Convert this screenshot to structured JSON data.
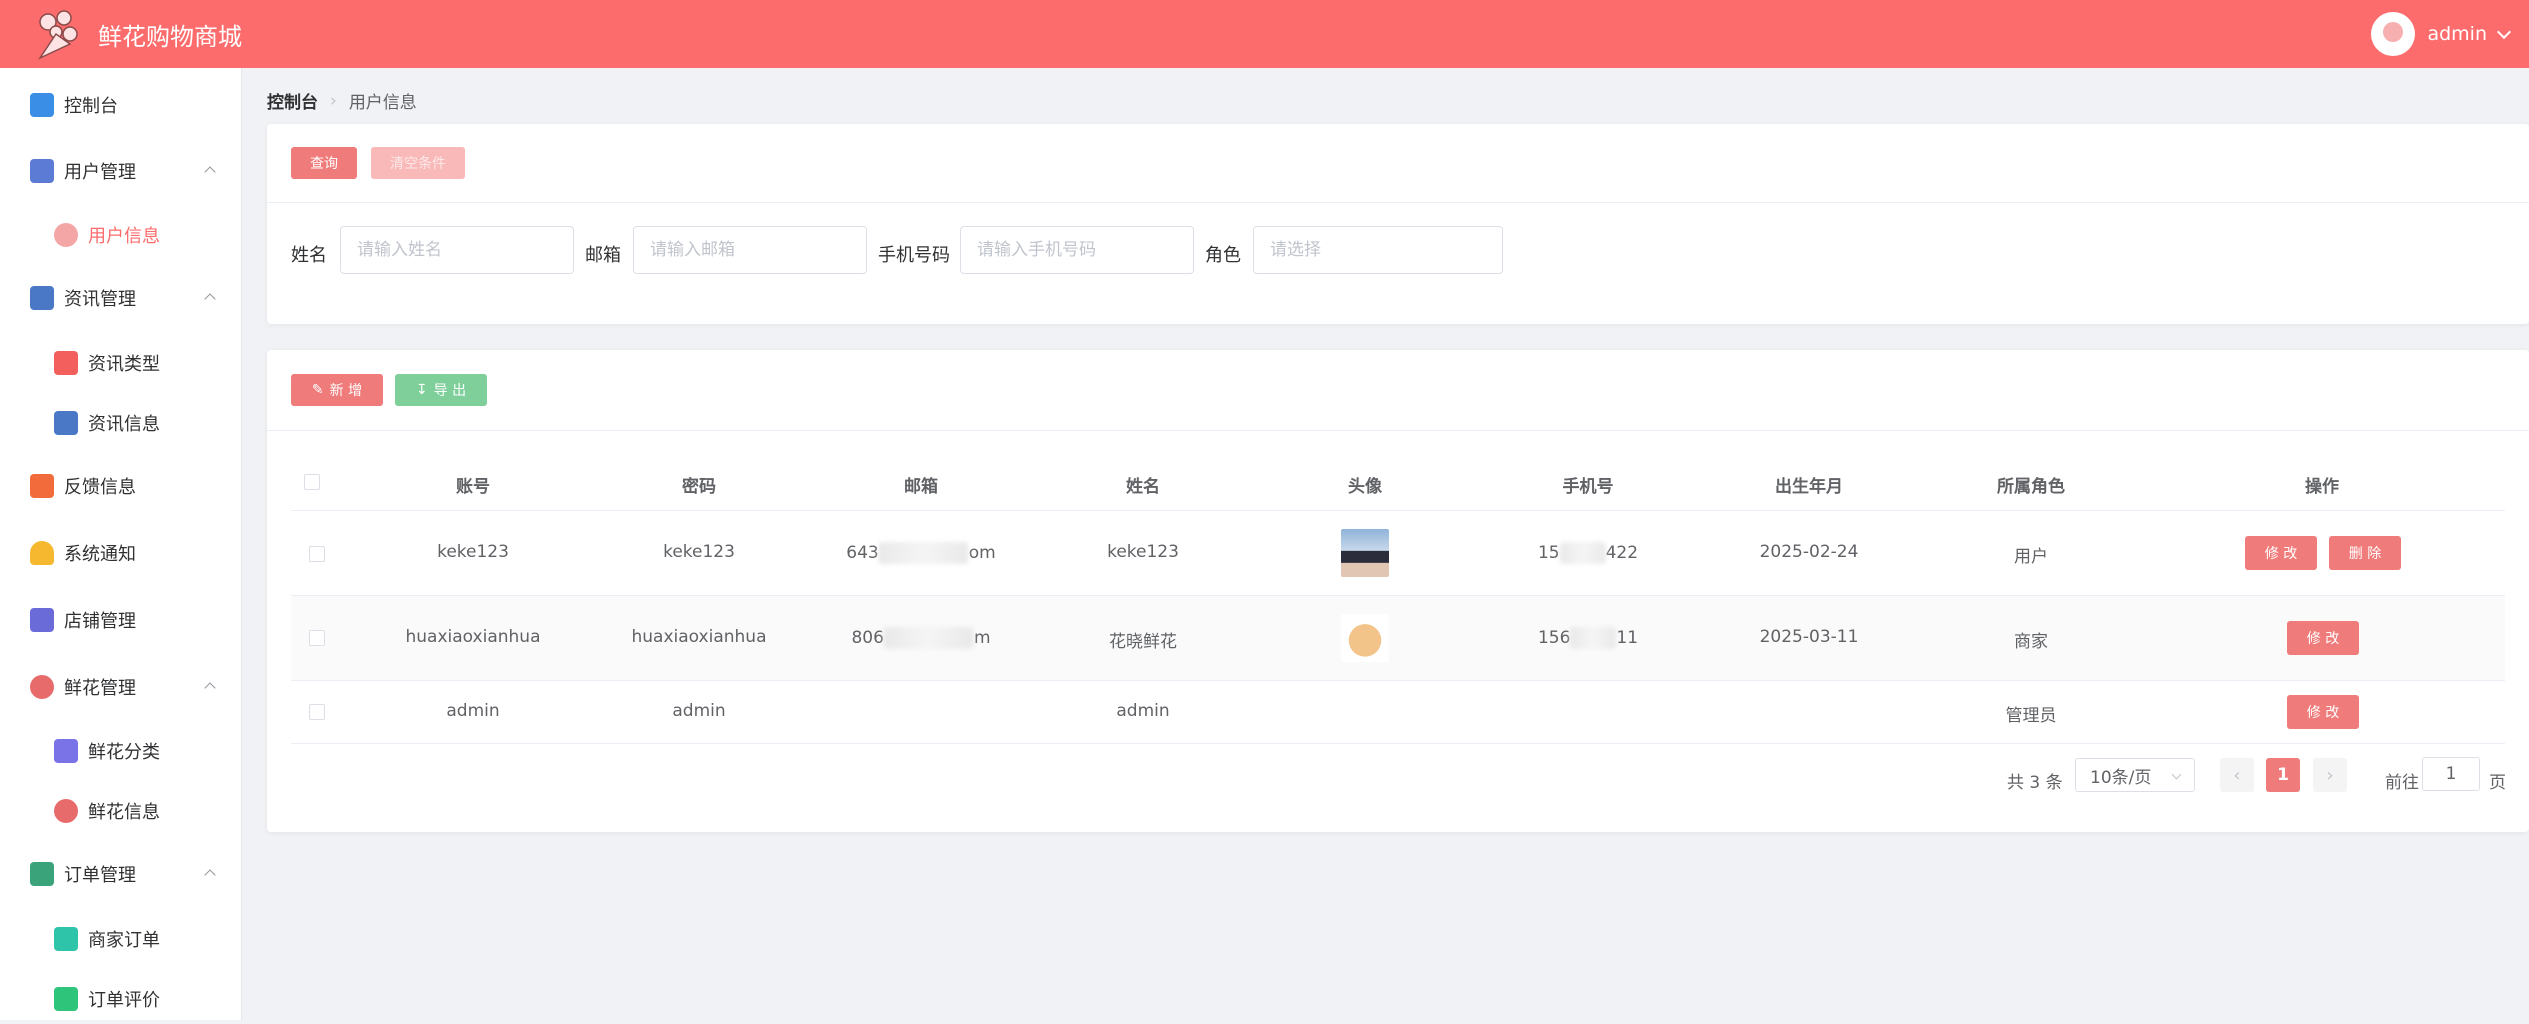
{
  "header": {
    "title": "鲜花购物商城",
    "username": "admin"
  },
  "sidebar": {
    "items": [
      {
        "label": "控制台",
        "icon": "dashboard-icon",
        "color": "#3a8ee6"
      },
      {
        "label": "用户管理",
        "icon": "user-manage-icon",
        "color": "#5b7bd5"
      },
      {
        "label": "用户信息",
        "icon": "user-info-icon",
        "color": "#f4a6a6"
      },
      {
        "label": "资讯管理",
        "icon": "news-manage-icon",
        "color": "#4a78c7"
      },
      {
        "label": "资讯类型",
        "icon": "news-type-icon",
        "color": "#f25f5c"
      },
      {
        "label": "资讯信息",
        "icon": "news-info-icon",
        "color": "#4a78c7"
      },
      {
        "label": "反馈信息",
        "icon": "feedback-icon",
        "color": "#f26b3a"
      },
      {
        "label": "系统通知",
        "icon": "bell-icon",
        "color": "#f5b82e"
      },
      {
        "label": "店铺管理",
        "icon": "shop-icon",
        "color": "#6a6bd8"
      },
      {
        "label": "鲜花管理",
        "icon": "flower-manage-icon",
        "color": "#e86b6b"
      },
      {
        "label": "鲜花分类",
        "icon": "flower-category-icon",
        "color": "#7a73e8"
      },
      {
        "label": "鲜花信息",
        "icon": "flower-info-icon",
        "color": "#e86b6b"
      },
      {
        "label": "订单管理",
        "icon": "order-manage-icon",
        "color": "#3aa37a"
      },
      {
        "label": "商家订单",
        "icon": "merchant-order-icon",
        "color": "#2ec4a9"
      },
      {
        "label": "订单评价",
        "icon": "order-review-icon",
        "color": "#2ec47a"
      }
    ]
  },
  "breadcrumb": {
    "root": "控制台",
    "current": "用户信息"
  },
  "search": {
    "query_label": "查询",
    "clear_label": "清空条件",
    "name_label": "姓名",
    "name_placeholder": "请输入姓名",
    "email_label": "邮箱",
    "email_placeholder": "请输入邮箱",
    "phone_label": "手机号码",
    "phone_placeholder": "请输入手机号码",
    "role_label": "角色",
    "role_placeholder": "请选择"
  },
  "toolbar": {
    "add_label": "新 增",
    "export_label": "导 出"
  },
  "table": {
    "columns": [
      "账号",
      "密码",
      "邮箱",
      "姓名",
      "头像",
      "手机号",
      "出生年月",
      "所属角色",
      "操作"
    ],
    "rows": [
      {
        "account": "keke123",
        "password": "keke123",
        "email_start": "643",
        "email_end": "om",
        "name": "keke123",
        "phone_start": "15",
        "phone_end": "422",
        "birth": "2025-02-24",
        "role": "用户",
        "avatar": "girl-avatar-image"
      },
      {
        "account": "huaxiaoxianhua",
        "password": "huaxiaoxianhua",
        "email_start": "806",
        "email_end": "m",
        "name": "花晓鲜花",
        "phone_start": "156",
        "phone_end": "11",
        "birth": "2025-03-11",
        "role": "商家",
        "avatar": "cat-avatar-image"
      },
      {
        "account": "admin",
        "password": "admin",
        "email_start": "",
        "email_end": "",
        "name": "admin",
        "phone_start": "",
        "phone_end": "",
        "birth": "",
        "role": "管理员",
        "avatar": ""
      }
    ],
    "edit_label": "修 改",
    "delete_label": "删 除"
  },
  "pagination": {
    "total_text": "共 3 条",
    "page_size": "10条/页",
    "current_page": "1",
    "goto_label": "前往",
    "goto_value": "1",
    "page_suffix": "页"
  },
  "colors": {
    "brand": "#fd6c6c",
    "danger": "#f07b7b",
    "success": "#7fcf9b"
  }
}
